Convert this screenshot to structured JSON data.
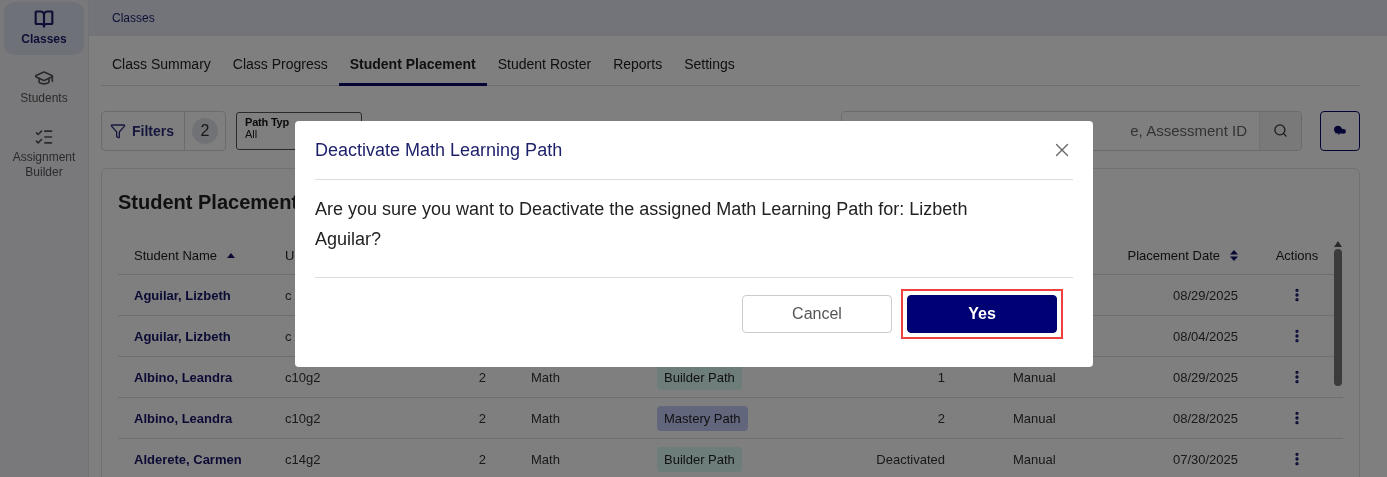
{
  "sidebar": {
    "items": [
      {
        "label": "Classes",
        "selected": true
      },
      {
        "label": "Students",
        "selected": false
      },
      {
        "label": "Assignment Builder",
        "selected": false
      }
    ]
  },
  "breadcrumb": "Classes",
  "tabs": [
    {
      "label": "Class Summary",
      "selected": false
    },
    {
      "label": "Class Progress",
      "selected": false
    },
    {
      "label": "Student Placement",
      "selected": true
    },
    {
      "label": "Student Roster",
      "selected": false
    },
    {
      "label": "Reports",
      "selected": false
    },
    {
      "label": "Settings",
      "selected": false
    }
  ],
  "toolbar": {
    "filters": {
      "label": "Filters",
      "count": "2"
    },
    "path_type": {
      "label": "Path Typ",
      "value": "All"
    },
    "search": {
      "placeholder": "e, Assessment ID"
    }
  },
  "card": {
    "title": "Student Placement",
    "columns": {
      "student_name": {
        "label": "Student Name",
        "sorted": true
      },
      "column_2": {
        "label": "U"
      },
      "placement_date": {
        "label": "Placement Date",
        "sorted": false
      },
      "actions": {
        "label": "Actions"
      }
    },
    "rows": [
      {
        "student_name": "Aguilar, Lizbeth",
        "column_2": "c",
        "placement_date": "08/29/2025"
      },
      {
        "student_name": "Aguilar, Lizbeth",
        "column_2": "c",
        "placement_date": "08/04/2025"
      },
      {
        "student_name": "Albino, Leandra",
        "column_2": "c10g2",
        "column_3": "2",
        "column_4": "Math",
        "column_5": {
          "label": "Builder Path",
          "kind": "builder"
        },
        "column_6": "1",
        "column_7": "Manual",
        "placement_date": "08/29/2025"
      },
      {
        "student_name": "Albino, Leandra",
        "column_2": "c10g2",
        "column_3": "2",
        "column_4": "Math",
        "column_5": {
          "label": "Mastery Path",
          "kind": "mastery"
        },
        "column_6": "2",
        "column_7": "Manual",
        "placement_date": "08/28/2025"
      },
      {
        "student_name": "Alderete, Carmen",
        "column_2": "c14g2",
        "column_3": "2",
        "column_4": "Math",
        "column_5": {
          "label": "Builder Path",
          "kind": "builder"
        },
        "column_6": "Deactivated",
        "column_7": "Manual",
        "placement_date": "07/30/2025"
      }
    ]
  },
  "dialog": {
    "title": "Deactivate Math Learning Path",
    "message": "Are you sure you want to Deactivate the assigned Math Learning Path for: Lizbeth Aguilar?",
    "buttons": [
      {
        "label": "Cancel",
        "kind": "secondary",
        "highlighted": false
      },
      {
        "label": "Yes",
        "kind": "primary",
        "highlighted": true
      }
    ]
  }
}
